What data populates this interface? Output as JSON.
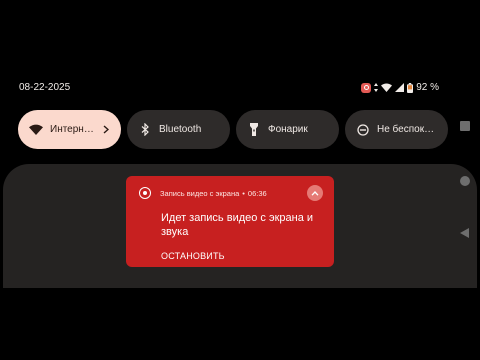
{
  "status_bar": {
    "date": "08-22-2025",
    "battery_percent": "92 %"
  },
  "quick_tiles": [
    {
      "label": "Интерн…",
      "icon": "wifi-icon",
      "active": true
    },
    {
      "label": "Bluetooth",
      "icon": "bluetooth-icon",
      "active": false
    },
    {
      "label": "Фонарик",
      "icon": "flashlight-icon",
      "active": false
    },
    {
      "label": "Не беспок…",
      "icon": "do-not-disturb-icon",
      "active": false
    }
  ],
  "notification": {
    "app_name": "Запись видео с экрана",
    "separator": "•",
    "time": "06:36",
    "title": "Идет запись видео с экрана и звука",
    "action": "ОСТАНОВИТЬ",
    "color": "#c72020"
  },
  "nav_bar": {
    "buttons": [
      "recents-button",
      "home-button",
      "back-button"
    ]
  }
}
